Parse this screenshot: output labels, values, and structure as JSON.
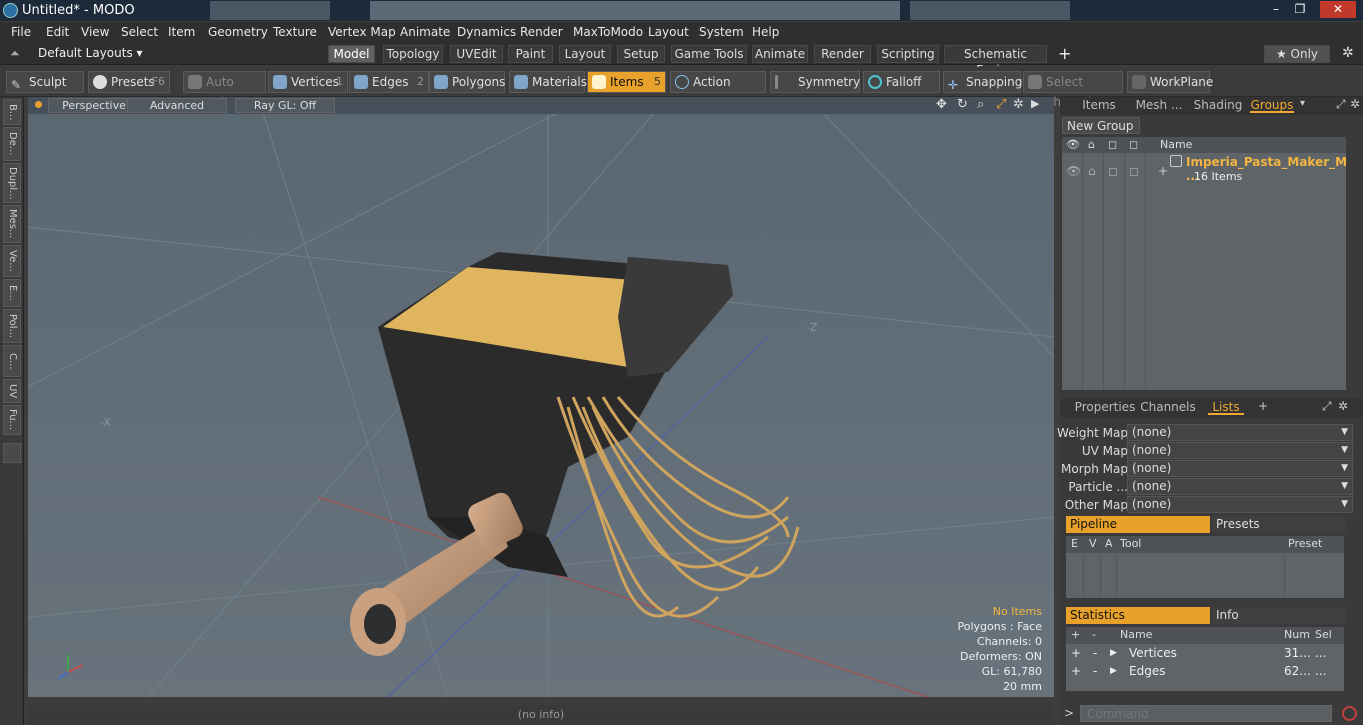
{
  "window": {
    "title": "Untitled* - MODO",
    "min": "–",
    "max": "❐",
    "close": "✕"
  },
  "menu": [
    "File",
    "Edit",
    "View",
    "Select",
    "Item",
    "Geometry",
    "Texture",
    "Vertex Map",
    "Animate",
    "Dynamics",
    "Render",
    "MaxToModo",
    "Layout",
    "System",
    "Help"
  ],
  "layouts": {
    "label": "Default Layouts ▾",
    "tabs": [
      "Model",
      "Topology",
      "UVEdit",
      "Paint",
      "Layout",
      "Setup",
      "Game Tools",
      "Animate",
      "Render",
      "Scripting",
      "Schematic Fusion"
    ],
    "active": "Model",
    "add": "+",
    "only": "★  Only",
    "gear": "✲"
  },
  "toolbar": {
    "sculpt": "Sculpt",
    "presets": "Presets",
    "presets_key": "F6",
    "auto_select": "Auto Select",
    "vertices": "Vertices",
    "vertices_key": "1",
    "edges": "Edges",
    "edges_key": "2",
    "polygons": "Polygons",
    "materials": "Materials",
    "items": "Items",
    "items_key": "5",
    "action_center": "Action Center",
    "symmetry": "Symmetry",
    "falloff": "Falloff",
    "snapping": "Snapping",
    "select_through": "Select Through",
    "workplane": "WorkPlane"
  },
  "left_tabs": [
    "B...",
    "De...",
    "Dupl...",
    "Mes...",
    "Ve...",
    "E...",
    "Pol...",
    "C...",
    "UV",
    "Fu..."
  ],
  "viewport": {
    "perspective": "Perspective",
    "advanced": "Advanced",
    "raygl": "Ray GL: Off",
    "axis_neg_z": "-Z",
    "axis_neg_x": "-X",
    "info": {
      "items": "No Items",
      "polygons": "Polygons : Face",
      "channels": "Channels: 0",
      "deformers": "Deformers: ON",
      "gl": "GL: 61,780",
      "scale": "20 mm"
    },
    "status": "(no info)"
  },
  "groups_panel": {
    "tabs": [
      "Items",
      "Mesh ...",
      "Shading",
      "Groups"
    ],
    "active": "Groups",
    "new_group": "New Group",
    "col_name": "Name",
    "group_name": "Imperia_Pasta_Maker_M ...",
    "group_count": "16 Items"
  },
  "lists_panel": {
    "tabs": [
      "Properties",
      "Channels",
      "Lists"
    ],
    "active": "Lists",
    "rows": [
      {
        "label": "Weight Map",
        "value": "(none)"
      },
      {
        "label": "UV Map",
        "value": "(none)"
      },
      {
        "label": "Morph Map",
        "value": "(none)"
      },
      {
        "label": "Particle   ...",
        "value": "(none)"
      },
      {
        "label": "Other Map",
        "value": "(none)"
      }
    ],
    "pipeline": "Pipeline",
    "presets": "Presets",
    "pipe_cols": [
      "E",
      "V",
      "A",
      "Tool",
      "Preset"
    ]
  },
  "stats_panel": {
    "statistics": "Statistics",
    "info": "Info",
    "cols": [
      "+",
      "-",
      "Name",
      "Num",
      "Sel"
    ],
    "rows": [
      {
        "plus": "+",
        "minus": "-",
        "name": "Vertices",
        "num": "31...",
        "sel": "..."
      },
      {
        "plus": "+",
        "minus": "-",
        "name": "Edges",
        "num": "62...",
        "sel": "..."
      }
    ]
  },
  "command": {
    "placeholder": "Command"
  }
}
